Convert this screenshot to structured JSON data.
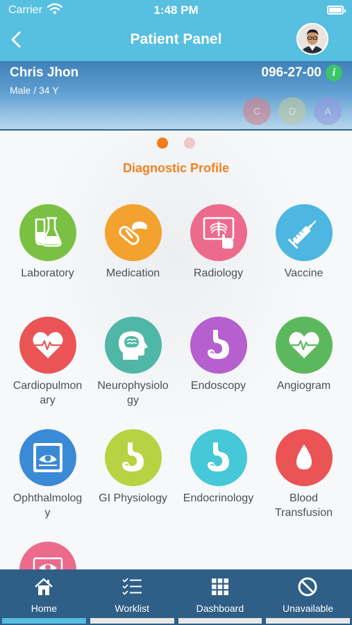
{
  "status_bar": {
    "carrier": "Carrier",
    "time": "1:48 PM",
    "wifi_icon": "wifi-icon",
    "battery_icon": "battery-icon"
  },
  "nav": {
    "title": "Patient Panel",
    "back_icon": "chevron-left-icon"
  },
  "patient": {
    "name": "Chris Jhon",
    "meta": "Male / 34 Y",
    "id": "096-27-00",
    "info_label": "i",
    "badges": [
      "C",
      "D",
      "A"
    ]
  },
  "pager": {
    "pages": 2,
    "active_index": 0
  },
  "section_title": "Diagnostic Profile",
  "profiles": [
    {
      "label": "Laboratory",
      "color": "#7ac143",
      "icon": "flask-icon"
    },
    {
      "label": "Medication",
      "color": "#f3a22f",
      "icon": "pills-icon"
    },
    {
      "label": "Radiology",
      "color": "#ec6b8d",
      "icon": "xray-icon"
    },
    {
      "label": "Vaccine",
      "color": "#4db6e1",
      "icon": "syringe-icon"
    },
    {
      "label": "Cardiopulmonary",
      "label_lines": [
        "Cardiopulmon",
        "ary"
      ],
      "color": "#ea5455",
      "icon": "heart-pulse-icon"
    },
    {
      "label": "Neurophysiology",
      "label_lines": [
        "Neurophysiolo",
        "gy"
      ],
      "color": "#4fb7a7",
      "icon": "brain-icon"
    },
    {
      "label": "Endoscopy",
      "color": "#b65fcf",
      "icon": "stomach-icon"
    },
    {
      "label": "Angiogram",
      "color": "#5cb85c",
      "icon": "heart-pulse-icon"
    },
    {
      "label": "Ophthalmology",
      "label_lines": [
        "Ophthalmolog",
        "y"
      ],
      "color": "#3a8ad6",
      "icon": "eye-scan-icon"
    },
    {
      "label": "GI Physiology",
      "color": "#b8d243",
      "icon": "stomach-icon"
    },
    {
      "label": "Endocrinology",
      "color": "#45c8d8",
      "icon": "stomach-icon"
    },
    {
      "label": "Blood Transfusion",
      "label_lines": [
        "Blood",
        "Transfusion"
      ],
      "color": "#ea5455",
      "icon": "blood-drop-icon"
    },
    {
      "label": "",
      "color": "#ec6b8d",
      "icon": "eye-card-icon"
    }
  ],
  "tabs": [
    {
      "label": "Home",
      "icon": "home-icon",
      "active": true
    },
    {
      "label": "Worklist",
      "icon": "checklist-icon",
      "active": false
    },
    {
      "label": "Dashboard",
      "icon": "grid-icon",
      "active": false
    },
    {
      "label": "Unavailable",
      "icon": "block-icon",
      "active": false
    }
  ]
}
